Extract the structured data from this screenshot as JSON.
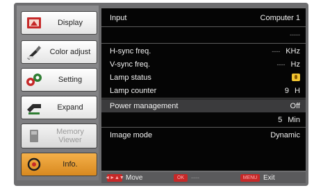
{
  "sidebar": {
    "items": [
      {
        "label": "Display",
        "icon": "display-icon",
        "state": "normal"
      },
      {
        "label": "Color adjust",
        "icon": "color-adjust-icon",
        "state": "normal"
      },
      {
        "label": "Setting",
        "icon": "setting-icon",
        "state": "normal"
      },
      {
        "label": "Expand",
        "icon": "expand-icon",
        "state": "normal"
      },
      {
        "label": "Memory Viewer",
        "icon": "memory-viewer-icon",
        "state": "disabled"
      },
      {
        "label": "Info.",
        "icon": "info-icon",
        "state": "selected"
      }
    ]
  },
  "info": {
    "rows": [
      {
        "label": "Input",
        "value": "Computer 1"
      },
      {
        "label": "",
        "value": "-----"
      },
      {
        "label": "H-sync freq.",
        "prefix": "----",
        "value": "KHz"
      },
      {
        "label": "V-sync freq.",
        "prefix": "----",
        "value": "Hz"
      },
      {
        "label": "Lamp status",
        "icon": "lamp-status-icon"
      },
      {
        "label": "Lamp counter",
        "value": "9",
        "unit": "H"
      },
      {
        "label": "Power management",
        "value": "Off"
      },
      {
        "label": "",
        "value": "5",
        "unit": "Min"
      },
      {
        "label": "Image mode",
        "value": "Dynamic"
      }
    ]
  },
  "footer": {
    "move_key": "◄►▲▼",
    "move_label": "Move",
    "ok_key": "OK",
    "ok_label": "----",
    "exit_key": "MENU",
    "exit_label": "Exit"
  },
  "colors": {
    "selected": "#e89a2c",
    "panel": "#050505",
    "highlight_row": "#3b3b3d",
    "key_button": "#c62828"
  }
}
